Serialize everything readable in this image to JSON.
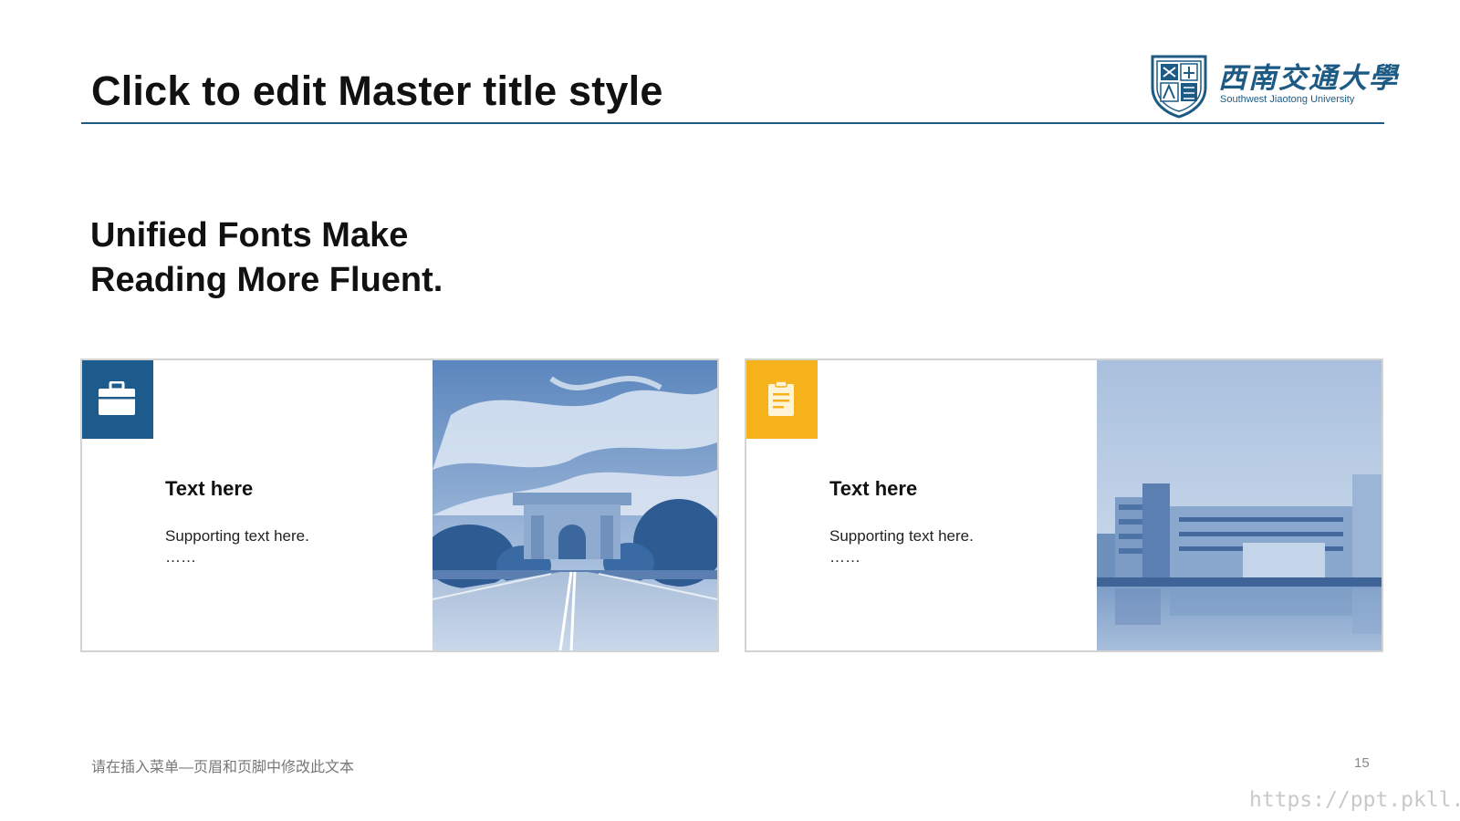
{
  "slide": {
    "title": "Click to edit Master title style",
    "subtitle_line1": "Unified Fonts Make",
    "subtitle_line2": "Reading More Fluent.",
    "page_number": "15",
    "footer_text": "请在插入菜单—页眉和页脚中修改此文本",
    "watermark": "https://ppt.pkll.de"
  },
  "logo": {
    "chinese_name": "西南交通大學",
    "english_name": "Southwest Jiaotong University"
  },
  "cards": [
    {
      "icon": "toolbox-icon",
      "accent_color": "#1d5b8c",
      "heading": "Text here",
      "support_text": "Supporting text here.",
      "ellipsis": "……",
      "photo": "campus-gate-photo"
    },
    {
      "icon": "clipboard-icon",
      "accent_color": "#f5b21b",
      "heading": "Text here",
      "support_text": "Supporting text here.",
      "ellipsis": "……",
      "photo": "campus-building-photo"
    }
  ],
  "colors": {
    "brand_blue": "#1d5b85",
    "accent_yellow": "#f5b21b",
    "rule": "#1d5b85"
  }
}
